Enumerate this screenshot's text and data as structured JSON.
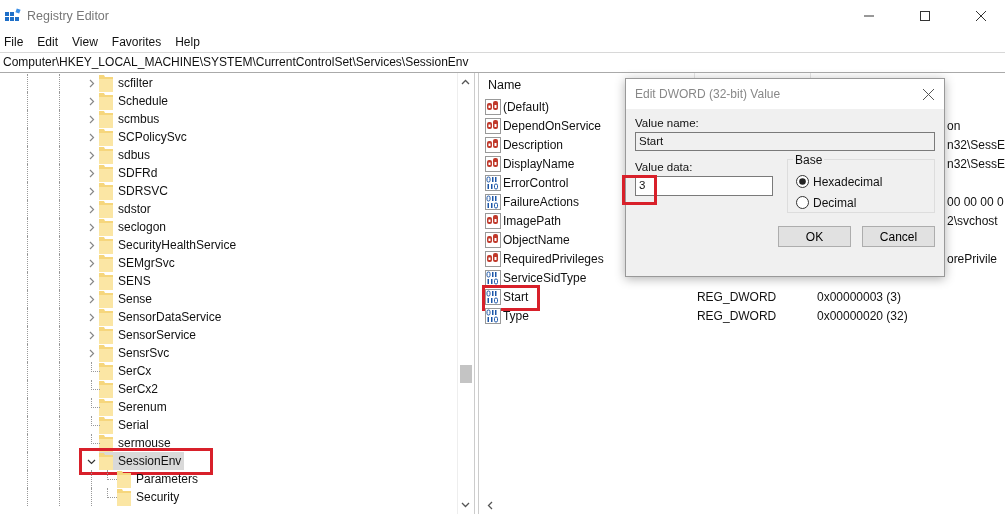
{
  "window": {
    "title": "Registry Editor"
  },
  "menu": [
    "File",
    "Edit",
    "View",
    "Favorites",
    "Help"
  ],
  "address": "Computer\\HKEY_LOCAL_MACHINE\\SYSTEM\\CurrentControlSet\\Services\\SessionEnv",
  "tree": [
    {
      "label": "scfilter",
      "has_children": true,
      "expanded": false,
      "selected": false,
      "highlighted": false
    },
    {
      "label": "Schedule",
      "has_children": true,
      "expanded": false,
      "selected": false,
      "highlighted": false
    },
    {
      "label": "scmbus",
      "has_children": true,
      "expanded": false,
      "selected": false,
      "highlighted": false
    },
    {
      "label": "SCPolicySvc",
      "has_children": true,
      "expanded": false,
      "selected": false,
      "highlighted": false
    },
    {
      "label": "sdbus",
      "has_children": true,
      "expanded": false,
      "selected": false,
      "highlighted": false
    },
    {
      "label": "SDFRd",
      "has_children": true,
      "expanded": false,
      "selected": false,
      "highlighted": false
    },
    {
      "label": "SDRSVC",
      "has_children": true,
      "expanded": false,
      "selected": false,
      "highlighted": false
    },
    {
      "label": "sdstor",
      "has_children": true,
      "expanded": false,
      "selected": false,
      "highlighted": false
    },
    {
      "label": "seclogon",
      "has_children": true,
      "expanded": false,
      "selected": false,
      "highlighted": false
    },
    {
      "label": "SecurityHealthService",
      "has_children": true,
      "expanded": false,
      "selected": false,
      "highlighted": false
    },
    {
      "label": "SEMgrSvc",
      "has_children": true,
      "expanded": false,
      "selected": false,
      "highlighted": false
    },
    {
      "label": "SENS",
      "has_children": true,
      "expanded": false,
      "selected": false,
      "highlighted": false
    },
    {
      "label": "Sense",
      "has_children": true,
      "expanded": false,
      "selected": false,
      "highlighted": false
    },
    {
      "label": "SensorDataService",
      "has_children": true,
      "expanded": false,
      "selected": false,
      "highlighted": false
    },
    {
      "label": "SensorService",
      "has_children": true,
      "expanded": false,
      "selected": false,
      "highlighted": false
    },
    {
      "label": "SensrSvc",
      "has_children": true,
      "expanded": false,
      "selected": false,
      "highlighted": false
    },
    {
      "label": "SerCx",
      "has_children": false,
      "selected": false,
      "highlighted": false
    },
    {
      "label": "SerCx2",
      "has_children": false,
      "selected": false,
      "highlighted": false
    },
    {
      "label": "Serenum",
      "has_children": false,
      "selected": false,
      "highlighted": false
    },
    {
      "label": "Serial",
      "has_children": false,
      "selected": false,
      "highlighted": false
    },
    {
      "label": "sermouse",
      "has_children": false,
      "selected": false,
      "highlighted": false
    },
    {
      "label": "SessionEnv",
      "has_children": true,
      "expanded": true,
      "selected": true,
      "highlighted": true,
      "children": [
        {
          "label": "Parameters",
          "selected": false,
          "highlighted": false
        },
        {
          "label": "Security",
          "selected": false,
          "highlighted": false
        }
      ]
    }
  ],
  "values": {
    "columns": [
      "Name"
    ],
    "rows": [
      {
        "name": "(Default)",
        "kind": "string",
        "highlighted": false
      },
      {
        "name": "DependOnService",
        "kind": "string",
        "data_tail": "on",
        "highlighted": false
      },
      {
        "name": "Description",
        "kind": "string",
        "data_tail": "n32\\SessE",
        "highlighted": false
      },
      {
        "name": "DisplayName",
        "kind": "string",
        "data_tail": "n32\\SessE",
        "highlighted": false
      },
      {
        "name": "ErrorControl",
        "kind": "binary",
        "highlighted": false
      },
      {
        "name": "FailureActions",
        "kind": "binary",
        "data_tail": "00 00 00 0",
        "highlighted": false
      },
      {
        "name": "ImagePath",
        "kind": "string",
        "data_tail": "2\\svchost",
        "highlighted": false
      },
      {
        "name": "ObjectName",
        "kind": "string",
        "highlighted": false
      },
      {
        "name": "RequiredPrivileges",
        "kind": "string",
        "data_tail": "orePrivile",
        "highlighted": false
      },
      {
        "name": "ServiceSidType",
        "kind": "binary",
        "highlighted": false
      },
      {
        "name": "Start",
        "kind": "binary",
        "type": "REG_DWORD",
        "data": "0x00000003 (3)",
        "highlighted": true
      },
      {
        "name": "Type",
        "kind": "binary",
        "type": "REG_DWORD",
        "data": "0x00000020 (32)",
        "highlighted": false
      }
    ]
  },
  "dialog": {
    "title": "Edit DWORD (32-bit) Value",
    "value_name_label": "Value name:",
    "value_name": "Start",
    "value_data_label": "Value data:",
    "value_data": "3",
    "value_data_highlighted": true,
    "base": {
      "label": "Base",
      "options": [
        {
          "label": "Hexadecimal",
          "selected": true
        },
        {
          "label": "Decimal",
          "selected": false
        }
      ]
    },
    "buttons": [
      "OK",
      "Cancel"
    ]
  }
}
